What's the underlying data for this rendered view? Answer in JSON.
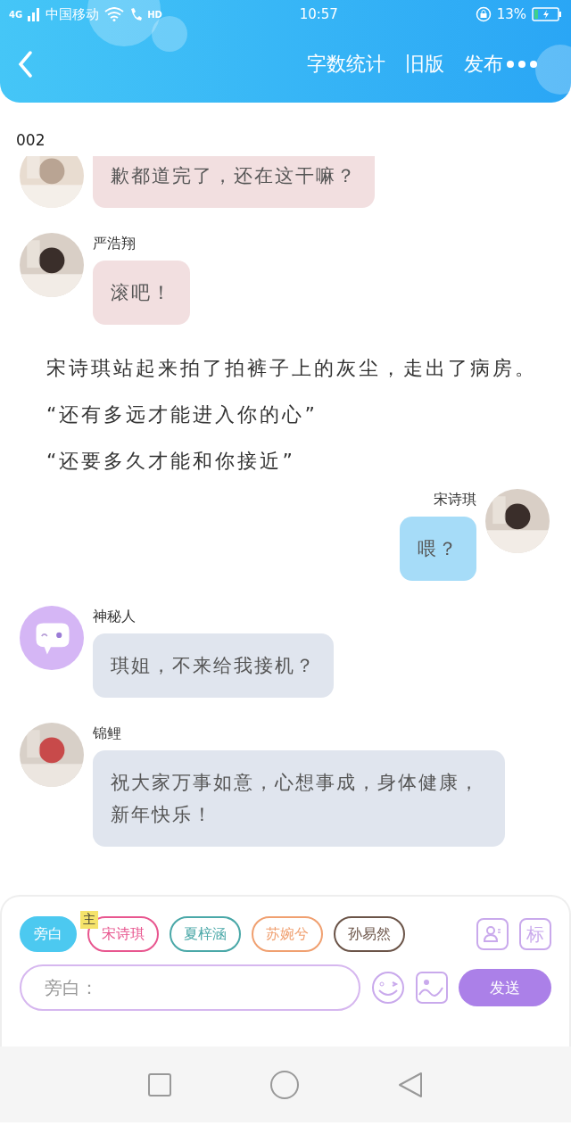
{
  "status_bar": {
    "network": "4G",
    "carrier": "中国移动",
    "call_badge": "HD",
    "time": "10:57",
    "battery": "13%"
  },
  "header": {
    "actions": [
      "字数统计",
      "旧版",
      "发布"
    ]
  },
  "chapter_title": "002",
  "messages": [
    {
      "kind": "left",
      "text": "歉都道完了，还在这干嘛？",
      "color": "#f2dfe0"
    },
    {
      "kind": "left",
      "name": "严浩翔",
      "text": "滚吧！",
      "color": "#f2dfe0"
    },
    {
      "kind": "narration",
      "text": "宋诗琪站起来拍了拍裤子上的灰尘，走出了病房。"
    },
    {
      "kind": "narration",
      "text": "“还有多远才能进入你的心”"
    },
    {
      "kind": "narration",
      "text": "“还要多久才能和你接近”"
    },
    {
      "kind": "right",
      "name": "宋诗琪",
      "text": "喂？",
      "color": "#a6dcf8"
    },
    {
      "kind": "left",
      "avatar": {
        "kind": "chat"
      },
      "name": "神秘人",
      "text": "琪姐，不来给我接机？",
      "color": "#e0e5ee"
    },
    {
      "kind": "left",
      "name": "锦鲤",
      "text": "祝大家万事如意，心想事成，身体健康，新年快乐！",
      "color": "#e0e5ee"
    }
  ],
  "roles": [
    {
      "label": "旁白",
      "selected": true,
      "color": "#4cc9f0"
    },
    {
      "label": "宋诗琪",
      "selected": false,
      "color": "#e8568f",
      "badge": "主"
    },
    {
      "label": "夏梓涵",
      "selected": false,
      "color": "#4aa8a8"
    },
    {
      "label": "苏婉兮",
      "selected": false,
      "color": "#f0a070"
    },
    {
      "label": "孙易然",
      "selected": false,
      "color": "#6b5448"
    }
  ],
  "tag_button": "标",
  "input": {
    "placeholder": "旁白："
  },
  "send_button": "发送"
}
